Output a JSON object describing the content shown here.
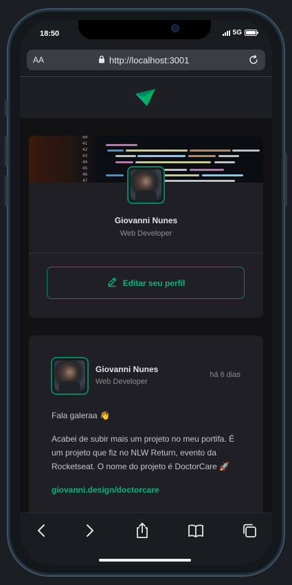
{
  "status_bar": {
    "time": "18:50",
    "network": "5G"
  },
  "browser": {
    "text_size_label": "AA",
    "url": "http://localhost:3001"
  },
  "profile": {
    "name": "Giovanni Nunes",
    "role": "Web Developer",
    "edit_label": "Editar seu perfil"
  },
  "post": {
    "author_name": "Giovanni Nunes",
    "author_role": "Web Developer",
    "time": "há 6 dias",
    "paragraphs": [
      "Fala galeraa 👋",
      "Acabei de subir mais um projeto no meu portifa. É um projeto que fiz no NLW Return, evento da Rocketseat. O nome do projeto é DoctorCare 🚀"
    ],
    "link": "giovanni.design/doctorcare"
  },
  "cover_line_numbers": [
    "40",
    "41",
    "42",
    "43",
    "44",
    "45",
    "46",
    "47"
  ],
  "colors": {
    "accent": "#00b37e",
    "accent_border": "#00875f",
    "card_bg": "#202024",
    "page_bg": "#121214",
    "text_primary": "#e1e1e6",
    "text_secondary": "#8d8d99"
  },
  "icons": [
    "back-icon",
    "forward-icon",
    "share-icon",
    "bookmarks-icon",
    "tabs-icon",
    "lock-icon",
    "reload-icon",
    "pencil-icon",
    "logo-icon"
  ]
}
